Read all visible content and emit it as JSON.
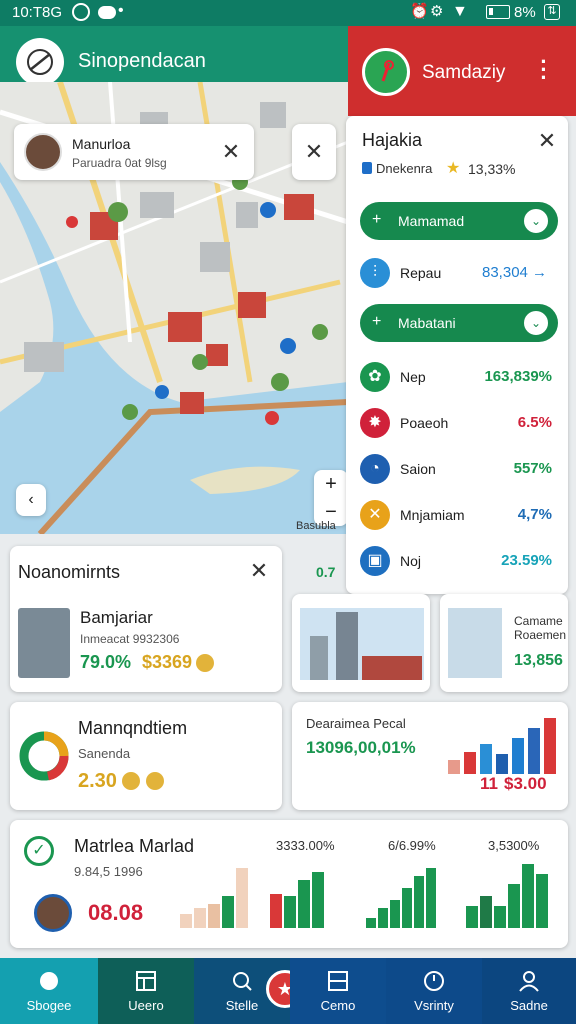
{
  "status": {
    "time": "10:T8G",
    "battery": "8%"
  },
  "app_title": "Sinopendacan",
  "right_header": {
    "title": "Samdaziy"
  },
  "map": {
    "profile_popup": {
      "name": "Manurloa",
      "subtitle": "Paruadra 0at 9lsg"
    },
    "bottom_label": "Basubla"
  },
  "side_panel": {
    "title": "Hajakia",
    "subtitle": "Dnekenra",
    "rating": "13,33%",
    "pill1": "Mamamad",
    "row_highlight": {
      "label": "Repau",
      "value": "83,304 →"
    },
    "pill2": "Mabatani",
    "rows": [
      {
        "label": "Nep",
        "value": "163,839%",
        "color": "#1a9650",
        "val_color": "#1a9650",
        "icon": "plant-icon"
      },
      {
        "label": "Poaeoh",
        "value": "6.5%",
        "color": "#d0213a",
        "val_color": "#d0213a",
        "icon": "sun-icon"
      },
      {
        "label": "Saion",
        "value": "557%",
        "color": "#1e5fb0",
        "val_color": "#1a9650",
        "icon": "clock-icon"
      },
      {
        "label": "Mnjamiam",
        "value": "4,7%",
        "color": "#e8a21a",
        "val_color": "#1f6cb5",
        "icon": "tools-icon"
      },
      {
        "label": "Noj",
        "value": "23.59%",
        "color": "#1e6fc0",
        "val_color": "#17a3b8",
        "icon": "wallet-icon"
      }
    ]
  },
  "card1": {
    "title": "Noanomirnts",
    "name": "Bamjariar",
    "subtitle": "Inmeacat 9932306",
    "stat_green": "79.0%",
    "stat_gold": "$3369",
    "peek": "0.7"
  },
  "photo_card": {
    "title": "Camame Roaemen",
    "value": "13,856"
  },
  "card2": {
    "title": "Mannqndtiem",
    "subtitle": "Sanenda",
    "value": "2.30"
  },
  "card3": {
    "subtitle": "Dearaimea Pecal",
    "value": "13096,00,01%",
    "footer_red": "$3.00",
    "footer_num": "11"
  },
  "card4": {
    "title": "Matrlea Marlad",
    "subtitle": "9.84,5 1996",
    "big": "08.08",
    "col_labels": [
      "3333.00%",
      "6/6.99%",
      "3,5300%"
    ]
  },
  "nav": [
    "Sbogee",
    "Ueero",
    "Stelle",
    "Cemo",
    "Vsrinty",
    "Sadne"
  ],
  "colors": {
    "green": "#169170",
    "red": "#cf2e2e",
    "blue": "#0d4f8a"
  }
}
